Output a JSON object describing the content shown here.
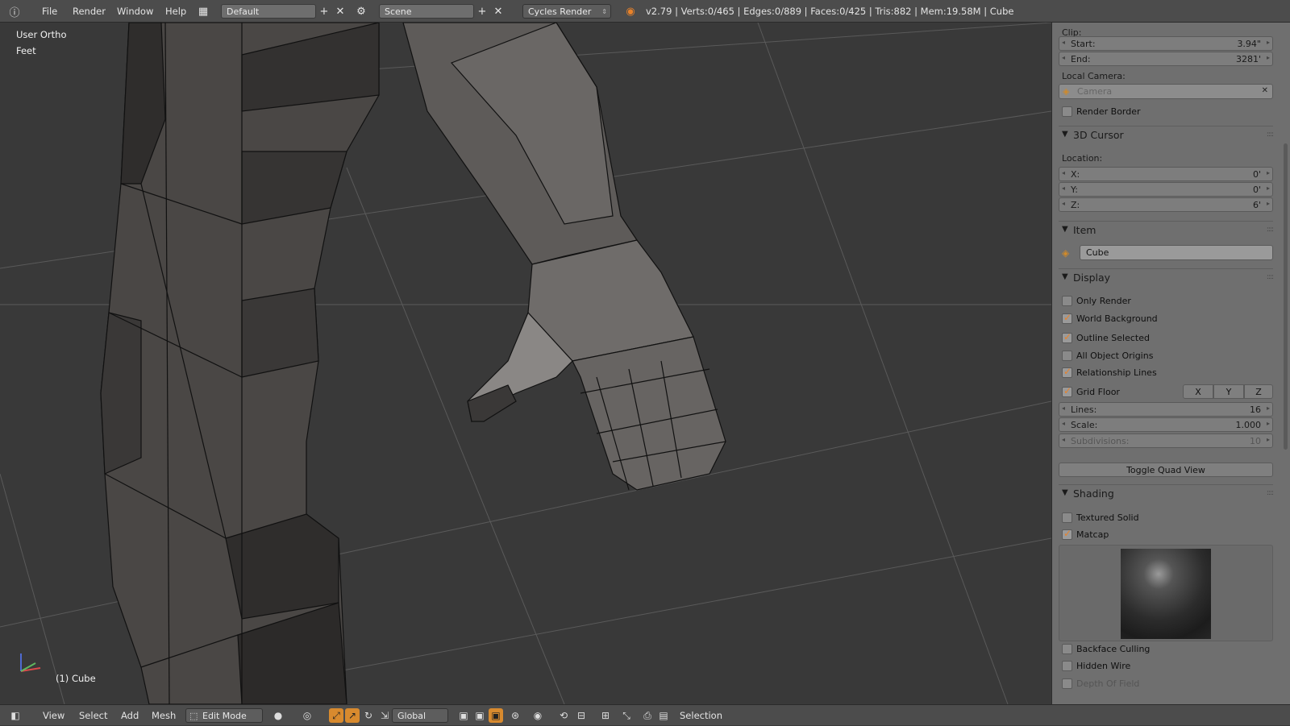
{
  "topbar": {
    "menus": [
      "File",
      "Render",
      "Window",
      "Help"
    ],
    "layout_name": "Default",
    "scene_name": "Scene",
    "render_engine": "Cycles Render",
    "stats": "v2.79 | Verts:0/465 | Edges:0/889 | Faces:0/425 | Tris:882 | Mem:19.58M | Cube"
  },
  "viewport": {
    "view_name": "User Ortho",
    "units": "Feet",
    "object_label": "(1) Cube",
    "axis_x": "x",
    "axis_y": "y",
    "axis_z": "z"
  },
  "panel": {
    "clip_label": "Clip:",
    "clip_start_label": "Start:",
    "clip_start_value": "3.94\"",
    "clip_end_label": "End:",
    "clip_end_value": "3281'",
    "local_camera_label": "Local Camera:",
    "camera_placeholder": "Camera",
    "render_border": "Render Border",
    "cursor_section": "3D Cursor",
    "location_label": "Location:",
    "cursor_x_label": "X:",
    "cursor_x_value": "0'",
    "cursor_y_label": "Y:",
    "cursor_y_value": "0'",
    "cursor_z_label": "Z:",
    "cursor_z_value": "6'",
    "item_section": "Item",
    "item_name": "Cube",
    "display_section": "Display",
    "only_render": "Only Render",
    "world_background": "World Background",
    "outline_selected": "Outline Selected",
    "all_object_origins": "All Object Origins",
    "relationship_lines": "Relationship Lines",
    "grid_floor": "Grid Floor",
    "axis_x_btn": "X",
    "axis_y_btn": "Y",
    "axis_z_btn": "Z",
    "lines_label": "Lines:",
    "lines_value": "16",
    "scale_label": "Scale:",
    "scale_value": "1.000",
    "subdivisions_label": "Subdivisions:",
    "subdivisions_value": "10",
    "toggle_quad_view": "Toggle Quad View",
    "shading_section": "Shading",
    "textured_solid": "Textured Solid",
    "matcap": "Matcap",
    "backface_culling": "Backface Culling",
    "hidden_wire": "Hidden Wire",
    "depth_of_field": "Depth Of Field"
  },
  "checkboxes": {
    "render_border": false,
    "only_render": false,
    "world_background": true,
    "outline_selected": true,
    "all_object_origins": false,
    "relationship_lines": true,
    "grid_floor": true,
    "textured_solid": false,
    "matcap": true,
    "backface_culling": false,
    "hidden_wire": false,
    "depth_of_field": false
  },
  "bottombar": {
    "menus": [
      "View",
      "Select",
      "Add",
      "Mesh"
    ],
    "mode": "Edit Mode",
    "orientation": "Global",
    "selection_label": "Selection"
  },
  "colors": {
    "accent": "#e8822a",
    "panel_bg": "#6f6f6f",
    "viewport_bg": "#393939",
    "header_bg": "#4c4c4c"
  }
}
